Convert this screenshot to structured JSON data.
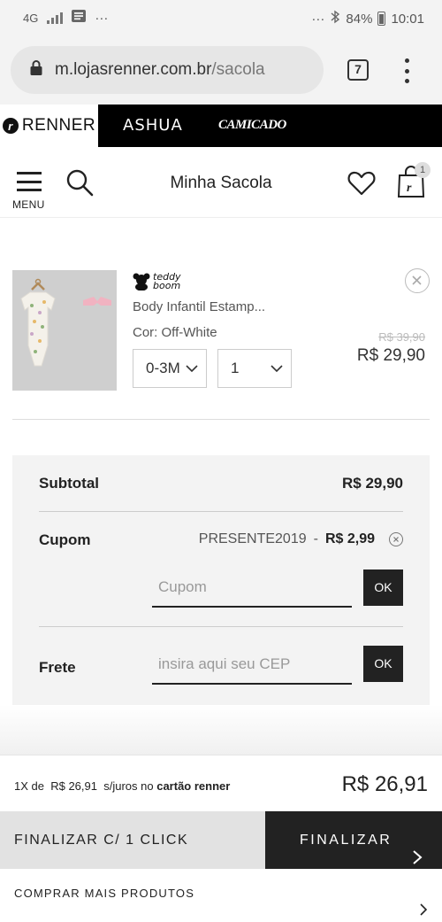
{
  "status_bar": {
    "network": "4G",
    "more": "···",
    "right_more": "···",
    "battery": "84%",
    "time": "10:01"
  },
  "browser": {
    "url_host": "m.lojasrenner.com.br",
    "url_path": "/sacola",
    "tab_count": "7"
  },
  "brands": {
    "renner": "RENNER",
    "ashua": "ASHUA",
    "camicado": "CAMICADO"
  },
  "header": {
    "menu_label": "MENU",
    "title": "Minha Sacola",
    "bag_count": "1"
  },
  "product": {
    "brand_logo_text": "teddy boom",
    "name": "Body Infantil Estamp...",
    "color": "Cor: Off-White",
    "size": "0-3M",
    "quantity": "1",
    "old_price": "R$ 39,90",
    "price": "R$ 29,90"
  },
  "summary": {
    "subtotal_label": "Subtotal",
    "subtotal_value": "R$ 29,90",
    "coupon_label": "Cupom",
    "coupon_code": "PRESENTE2019",
    "coupon_separator": "-",
    "coupon_discount": "R$ 2,99",
    "coupon_placeholder": "Cupom",
    "ok_label": "OK",
    "shipping_label": "Frete",
    "shipping_placeholder": "insira aqui seu CEP"
  },
  "footer": {
    "installment_prefix": "1X de",
    "installment_value": "R$ 26,91",
    "installment_suffix": "s/juros no",
    "installment_card": "cartão renner",
    "total": "R$ 26,91",
    "one_click_label": "FINALIZAR C/ 1 CLICK",
    "checkout_label": "FINALIZAR",
    "more_products_label": "COMPRAR MAIS PRODUTOS"
  }
}
